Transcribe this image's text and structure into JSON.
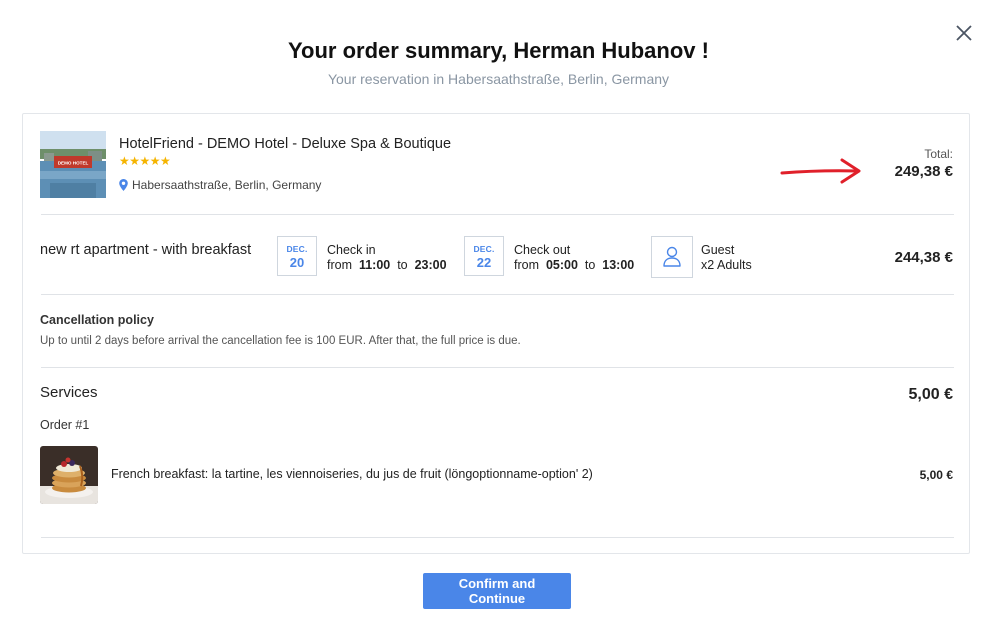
{
  "header": {
    "title": "Your order summary, Herman Hubanov !",
    "subtitle": "Your reservation in Habersaathstraße, Berlin, Germany",
    "close_icon": "close-icon"
  },
  "hotel": {
    "name": "HotelFriend - DEMO Hotel - Deluxe Spa & Boutique",
    "stars": "★★★★★",
    "address": "Habersaathstraße, Berlin, Germany",
    "image_sign": "DEMO HOTEL",
    "total_label": "Total:",
    "total_value": "249,38 €"
  },
  "room": {
    "name": "new rt apartment - with breakfast",
    "checkin": {
      "month": "DEC.",
      "day": "20",
      "label": "Check in",
      "prefix": "from",
      "from": "11:00",
      "sep": "to",
      "to": "23:00"
    },
    "checkout": {
      "month": "DEC.",
      "day": "22",
      "label": "Check out",
      "prefix": "from",
      "from": "05:00",
      "sep": "to",
      "to": "13:00"
    },
    "guest": {
      "label": "Guest",
      "value": "x2 Adults"
    },
    "price": "244,38 €"
  },
  "cancellation": {
    "title": "Cancellation policy",
    "text": "Up to until 2 days before arrival the cancellation fee is 100 EUR. After that, the full price is due."
  },
  "services": {
    "title": "Services",
    "total": "5,00 €",
    "order_label": "Order #1",
    "items": [
      {
        "name": "French breakfast: la tartine, les viennoiseries, du jus de fruit (löngoptionname-option' 2)",
        "price": "5,00 €"
      }
    ]
  },
  "footer": {
    "confirm_label": "Confirm and Continue"
  },
  "colors": {
    "accent": "#4a86e8",
    "star": "#f5b400",
    "arrow": "#e0202a"
  }
}
